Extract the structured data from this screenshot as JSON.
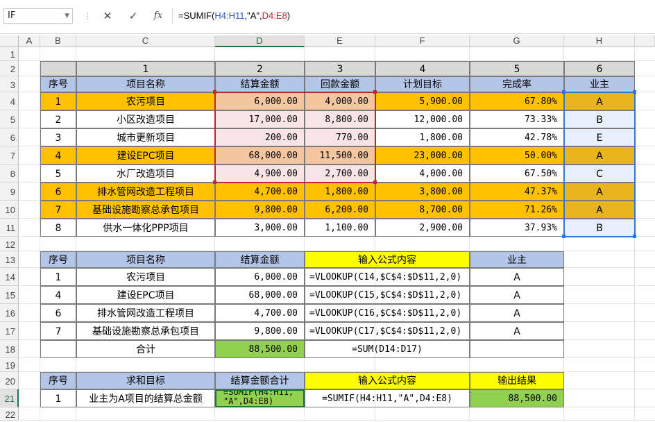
{
  "formula_bar": {
    "name_box": "IF",
    "cancel_icon": "✕",
    "enter_icon": "✓",
    "fx_label": "fx",
    "formula_parts": [
      "=SUMIF(",
      "H4:H11",
      ",\"A\",",
      "D4:E8",
      ")"
    ]
  },
  "columns": [
    "A",
    "B",
    "C",
    "D",
    "E",
    "F",
    "G",
    "H"
  ],
  "rows": [
    "1",
    "2",
    "3",
    "4",
    "5",
    "6",
    "7",
    "8",
    "9",
    "10",
    "11",
    "12",
    "13",
    "14",
    "15",
    "16",
    "17",
    "18",
    "19",
    "20",
    "21",
    "22"
  ],
  "table1": {
    "index_row": [
      "1",
      "2",
      "3",
      "4",
      "5",
      "6"
    ],
    "headers": [
      "序号",
      "项目名称",
      "结算金额",
      "回款金额",
      "计划目标",
      "完成率",
      "业主"
    ],
    "rows": [
      [
        "1",
        "农污项目",
        "6,000.00",
        "4,000.00",
        "5,900.00",
        "67.80%",
        "A"
      ],
      [
        "2",
        "小区改造项目",
        "17,000.00",
        "8,800.00",
        "12,000.00",
        "73.33%",
        "B"
      ],
      [
        "3",
        "城市更新项目",
        "200.00",
        "770.00",
        "1,800.00",
        "42.78%",
        "E"
      ],
      [
        "4",
        "建设EPC项目",
        "68,000.00",
        "11,500.00",
        "23,000.00",
        "50.00%",
        "A"
      ],
      [
        "5",
        "水厂改造项目",
        "4,900.00",
        "2,700.00",
        "4,000.00",
        "67.50%",
        "C"
      ],
      [
        "6",
        "排水管网改造工程项目",
        "4,700.00",
        "1,800.00",
        "3,800.00",
        "47.37%",
        "A"
      ],
      [
        "7",
        "基础设施勘察总承包项目",
        "9,800.00",
        "6,200.00",
        "8,700.00",
        "71.26%",
        "A"
      ],
      [
        "8",
        "供水一体化PPP项目",
        "3,000.00",
        "1,100.00",
        "2,900.00",
        "37.93%",
        "B"
      ]
    ]
  },
  "table2": {
    "headers": [
      "序号",
      "项目名称",
      "结算金额",
      "输入公式内容",
      "业主"
    ],
    "rows": [
      [
        "1",
        "农污项目",
        "6,000.00",
        "=VLOOKUP(C14,$C$4:$D$11,2,0)",
        "A"
      ],
      [
        "4",
        "建设EPC项目",
        "68,000.00",
        "=VLOOKUP(C15,$C$4:$D$11,2,0)",
        "A"
      ],
      [
        "6",
        "排水管网改造工程项目",
        "4,700.00",
        "=VLOOKUP(C16,$C$4:$D$11,2,0)",
        "A"
      ],
      [
        "7",
        "基础设施勘察总承包项目",
        "9,800.00",
        "=VLOOKUP(C17,$C$4:$D$11,2,0)",
        "A"
      ]
    ],
    "total_label": "合计",
    "total_value": "88,500.00",
    "total_formula": "=SUM(D14:D17)"
  },
  "table3": {
    "headers": [
      "序号",
      "求和目标",
      "结算金额合计",
      "输入公式内容",
      "输出结果"
    ],
    "row": [
      "1",
      "业主为A项目的结算总金额",
      "=SUMIF(H4:H11,",
      "\"A\",D4:E8)",
      "=SUMIF(H4:H11,\"A\",D4:E8)",
      "88,500.00"
    ]
  },
  "colors": {
    "orange": "#ffc000",
    "header_blue": "#b4c6e7",
    "yellow": "#ffff00",
    "green": "#92d050",
    "gray_index": "#d9d9d9",
    "selection_pink": "#f8e4e6",
    "selection_blue": "#e8eefa",
    "excel_green": "#217346"
  }
}
